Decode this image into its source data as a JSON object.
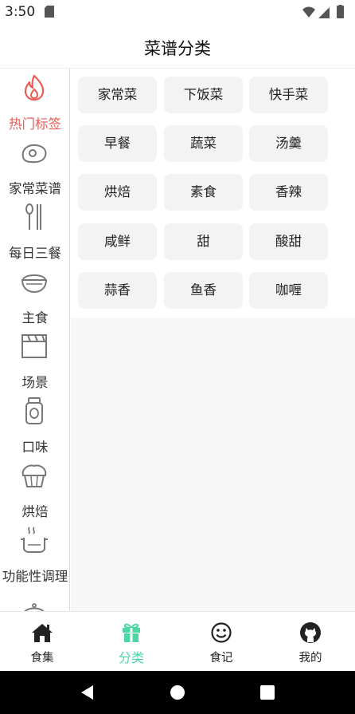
{
  "status_bar": {
    "time": "3:50"
  },
  "header": {
    "title": "菜谱分类"
  },
  "sidebar": {
    "items": [
      {
        "label": "热门标签",
        "icon": "fire-icon",
        "active": true
      },
      {
        "label": "家常菜谱",
        "icon": "egg-plate-icon",
        "active": false
      },
      {
        "label": "每日三餐",
        "icon": "spoon-fork-icon",
        "active": false
      },
      {
        "label": "主食",
        "icon": "rice-bowl-icon",
        "active": false
      },
      {
        "label": "场景",
        "icon": "clapperboard-icon",
        "active": false
      },
      {
        "label": "口味",
        "icon": "sauce-jar-icon",
        "active": false
      },
      {
        "label": "烘焙",
        "icon": "muffin-icon",
        "active": false
      },
      {
        "label": "功能性调理",
        "icon": "steaming-pot-icon",
        "active": false
      },
      {
        "label": "",
        "icon": "cloche-icon",
        "active": false
      }
    ]
  },
  "tags": [
    [
      "家常菜",
      "下饭菜",
      "快手菜"
    ],
    [
      "早餐",
      "蔬菜",
      "汤羹"
    ],
    [
      "烘焙",
      "素食",
      "香辣"
    ],
    [
      "咸鲜",
      "甜",
      "酸甜"
    ],
    [
      "蒜香",
      "鱼香",
      "咖喱"
    ]
  ],
  "bottom_nav": {
    "items": [
      {
        "label": "食集",
        "icon": "home-icon",
        "active": false
      },
      {
        "label": "分类",
        "icon": "gift-icon",
        "active": true
      },
      {
        "label": "食记",
        "icon": "smiley-icon",
        "active": false
      },
      {
        "label": "我的",
        "icon": "github-icon",
        "active": false
      }
    ]
  },
  "colors": {
    "active_sidebar": "#e85b57",
    "active_tab": "#4cd7a5",
    "tag_bg": "#f3f3f3"
  }
}
